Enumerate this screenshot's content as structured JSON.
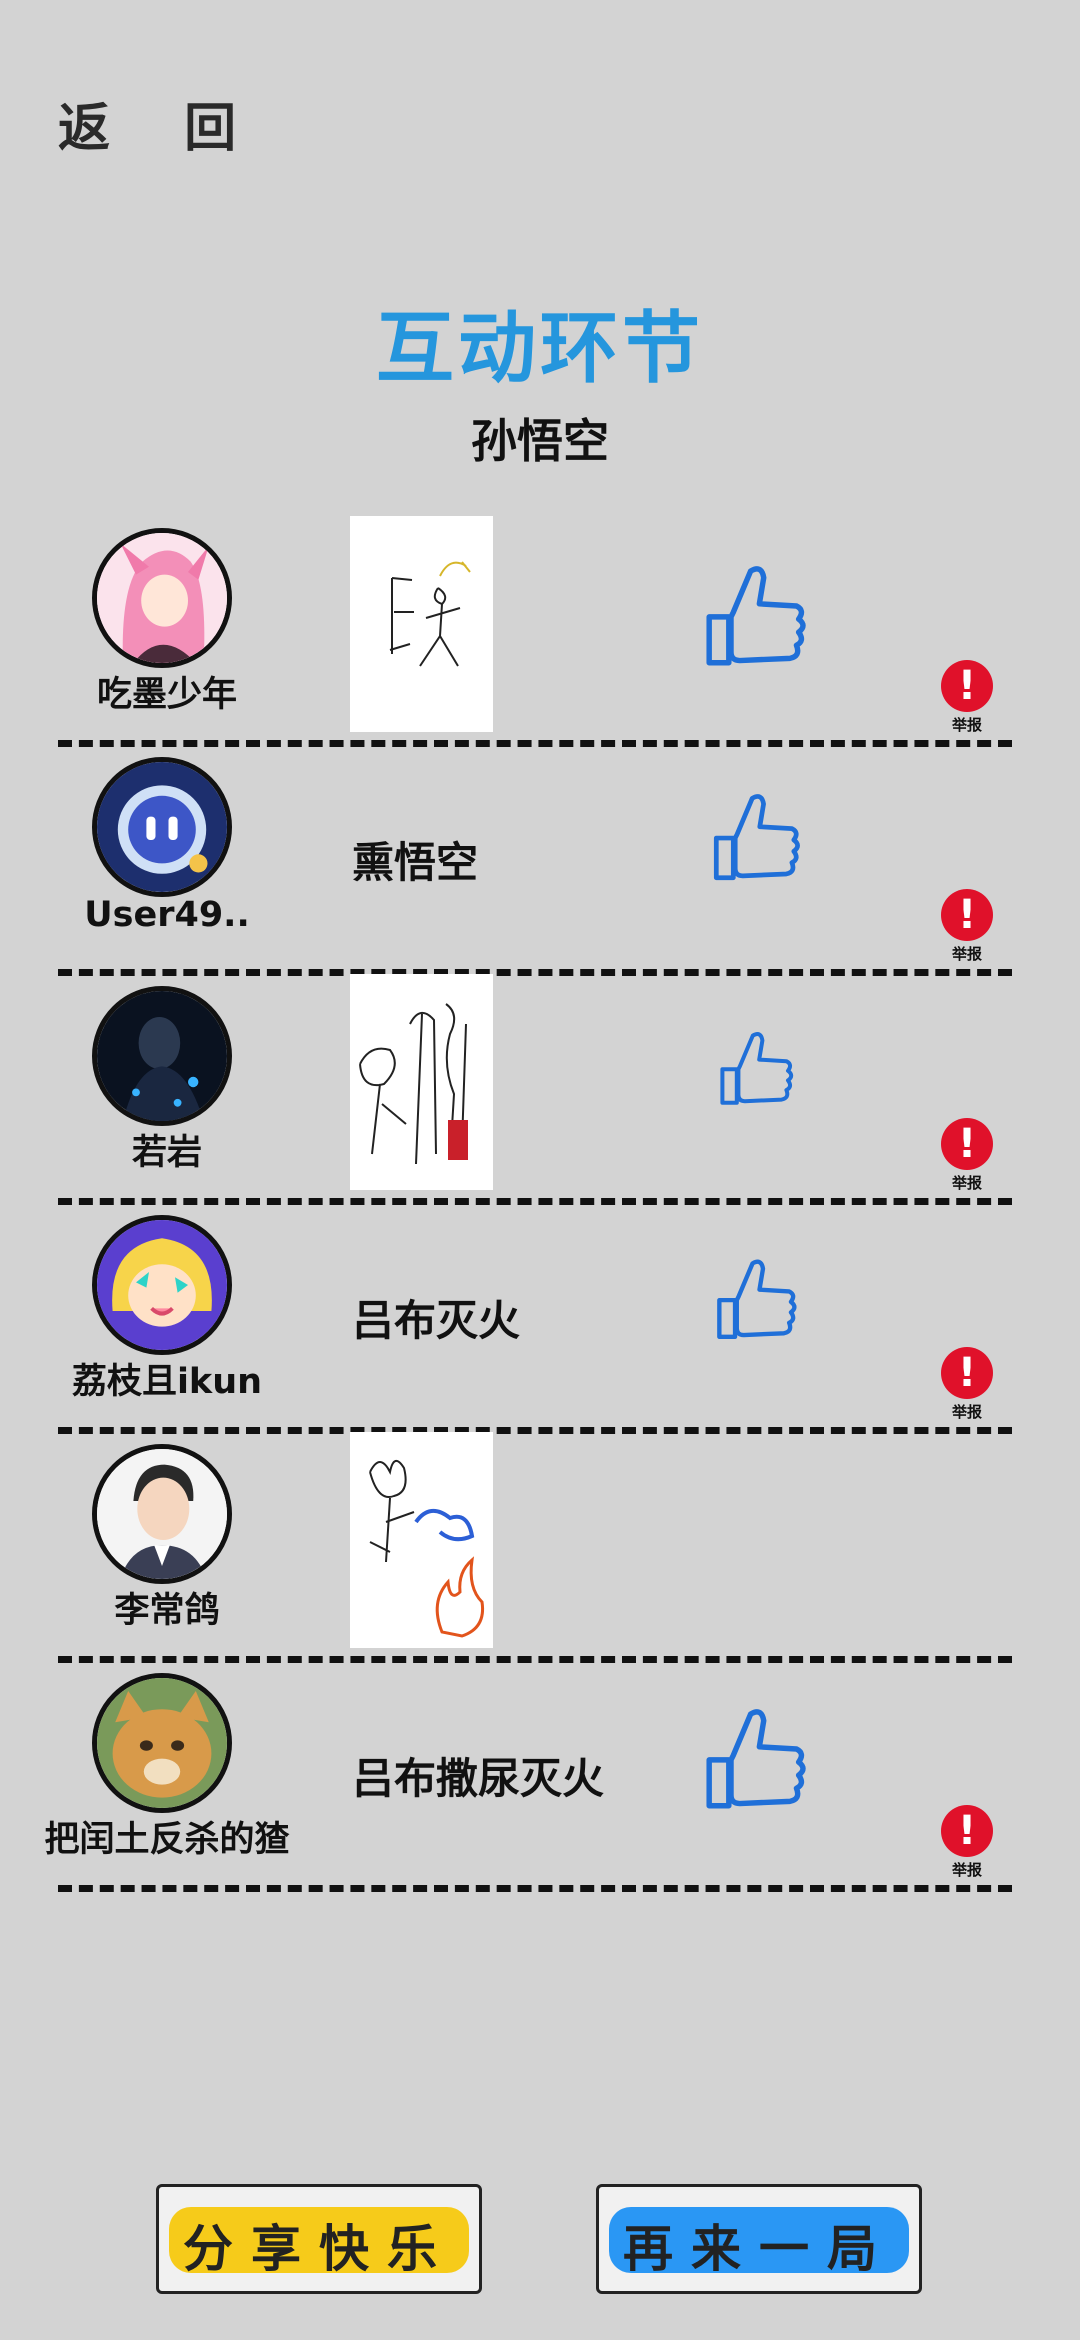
{
  "header": {
    "back_label": "返 回"
  },
  "title": "互动环节",
  "topic": "孙悟空",
  "report_label": "举报",
  "colors": {
    "accent": "#2596dd",
    "like": "#1f6fd8",
    "report": "#e0112a",
    "share": "#f6cb1a",
    "replay": "#2a97f4"
  },
  "rows": [
    {
      "name": "吃墨少年",
      "answer_type": "drawing",
      "answer": "",
      "liked": true
    },
    {
      "name": "User49..",
      "answer_type": "text",
      "answer": "熏悟空",
      "liked": true
    },
    {
      "name": "若岩",
      "answer_type": "drawing",
      "answer": "",
      "liked": true
    },
    {
      "name": "荔枝且ikun",
      "answer_type": "text",
      "answer": "吕布灭火",
      "liked": true
    },
    {
      "name": "李常鸽",
      "answer_type": "drawing",
      "answer": "",
      "liked": false
    },
    {
      "name": "把闰土反杀的猹",
      "answer_type": "text",
      "answer": "吕布撒尿灭火",
      "liked": true
    }
  ],
  "buttons": {
    "share": "分享快乐",
    "replay": "再来一局"
  },
  "icons": [
    "thumbs-up-icon",
    "report-icon"
  ]
}
